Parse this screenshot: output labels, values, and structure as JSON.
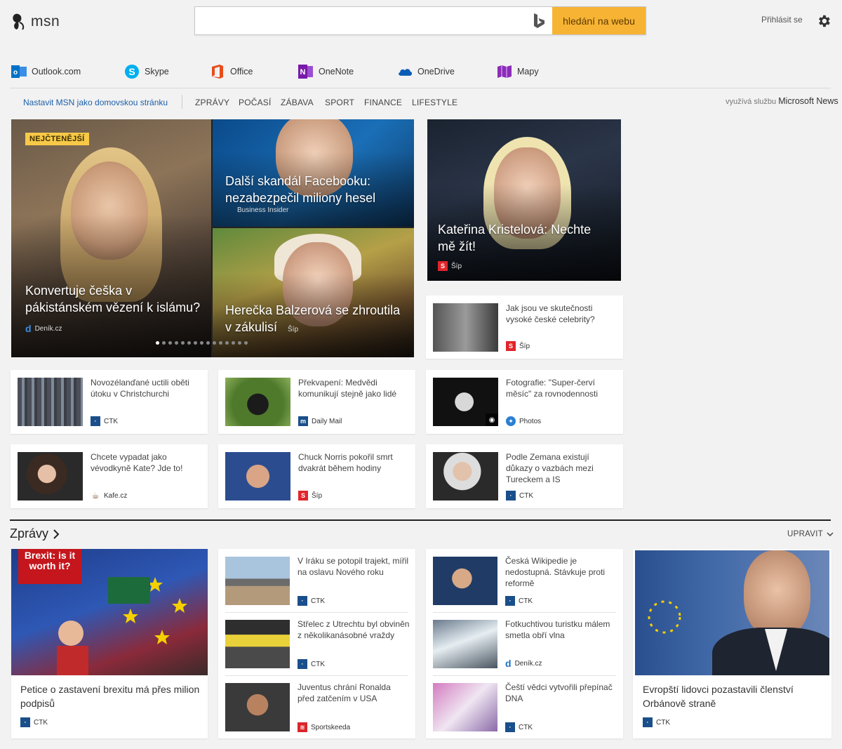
{
  "header": {
    "logo_text": "msn",
    "search_placeholder": "",
    "search_button": "hledání na webu",
    "signin": "Přihlásit se"
  },
  "apps": [
    {
      "label": "Outlook.com",
      "icon": "outlook-icon",
      "color": "#0072c6"
    },
    {
      "label": "Skype",
      "icon": "skype-icon",
      "color": "#00aff0"
    },
    {
      "label": "Office",
      "icon": "office-icon",
      "color": "#e74c1c"
    },
    {
      "label": "OneNote",
      "icon": "onenote-icon",
      "color": "#7719aa"
    },
    {
      "label": "OneDrive",
      "icon": "onedrive-icon",
      "color": "#0a5bb5"
    },
    {
      "label": "Mapy",
      "icon": "maps-icon",
      "color": "#8b2db8"
    }
  ],
  "nav": {
    "set_home": "Nastavit MSN jako domovskou stránku",
    "items": [
      "ZPRÁVY",
      "POČASÍ",
      "ZÁBAVA",
      "SPORT",
      "FINANCE",
      "LIFESTYLE"
    ],
    "powered_prefix": "využívá službu",
    "powered_name": "Microsoft News"
  },
  "hero": {
    "badge": "NEJČTENĚJŠÍ",
    "main": {
      "title": "Konvertuje češka v pákistánském vězení k islámu?",
      "source": "Deník.cz"
    },
    "top_right": {
      "title": "Další skandál Facebooku: nezabezpečil miliony hesel",
      "source": "Business Insider"
    },
    "bottom_right": {
      "title": "Herečka Balzerová se zhroutila v zákulisí",
      "source": "Šíp"
    },
    "dots_total": 15,
    "dots_active": 0
  },
  "side_feature": {
    "title": "Kateřina Kristelová: Nechte mě žít!",
    "source": "Šíp"
  },
  "cards": [
    {
      "title": "Jak jsou ve skutečnosti vysoké české celebrity?",
      "source": "Šíp"
    },
    {
      "title": "Novozélanďané uctili oběti útoku v Christchurchi",
      "source": "CTK"
    },
    {
      "title": "Překvapení: Medvědi komunikují stejně jako lidé",
      "source": "Daily Mail"
    },
    {
      "title": "Fotografie: \"Super-červí měsíc\" za rovnodennosti",
      "source": "Photos"
    },
    {
      "title": "Chcete vypadat jako vévodkyně Kate? Jde to!",
      "source": "Kafe.cz"
    },
    {
      "title": "Chuck Norris pokořil smrt dvakrát během hodiny",
      "source": "Šíp"
    },
    {
      "title": "Podle Zemana existují důkazy o vazbách mezi Tureckem a IS",
      "source": "CTK"
    }
  ],
  "section": {
    "title": "Zprávy",
    "edit": "UPRAVIT",
    "big_left": {
      "title": "Petice o zastavení brexitu má přes milion podpisů",
      "source": "CTK",
      "sign_text": "Brexit: is it worth it?"
    },
    "col2": [
      {
        "title": "V Iráku se potopil trajekt, mířil na oslavu Nového roku",
        "source": "CTK"
      },
      {
        "title": "Střelec z Utrechtu byl obviněn z několikanásobné vraždy",
        "source": "CTK"
      },
      {
        "title": "Juventus chrání Ronalda před zatčením v USA",
        "source": "Sportskeeda"
      }
    ],
    "col3": [
      {
        "title": "Česká Wikipedie je nedostupná. Stávkuje proti reformě",
        "source": "CTK"
      },
      {
        "title": "Fotkuchtivou turistku málem smetla obří vlna",
        "source": "Deník.cz"
      },
      {
        "title": "Čeští vědci vytvořili přepínač DNA",
        "source": "CTK"
      }
    ],
    "big_right": {
      "title": "Evropští lidovci pozastavili členství Orbánově straně",
      "source": "CTK"
    }
  },
  "colors": {
    "accent": "#f7b334",
    "link": "#1b5fa8",
    "ctk": "#1a4f8b",
    "sip": "#e0262b"
  }
}
